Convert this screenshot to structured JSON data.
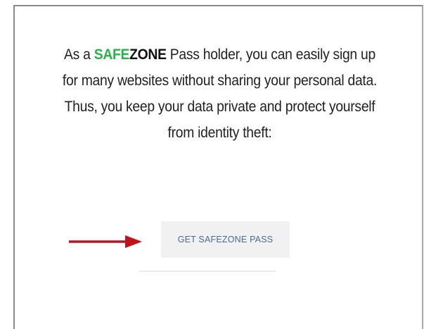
{
  "message": {
    "line1_prefix": "As a ",
    "brand_safe": "SAFE",
    "brand_zone": "ZONE",
    "line1_suffix": " Pass holder, you can easily sign up",
    "line2": "for many websites without sharing your personal data.",
    "line3": "Thus, you keep your data private and protect yourself",
    "line4": "from identity theft:"
  },
  "cta": {
    "label": "GET SAFEZONE PASS"
  },
  "colors": {
    "brand_green": "#27b34a",
    "arrow_red": "#c0141a",
    "button_bg": "#f1f1f1",
    "button_text": "#4a6a9a"
  },
  "icons": {
    "pointer": "arrow-right-icon"
  }
}
